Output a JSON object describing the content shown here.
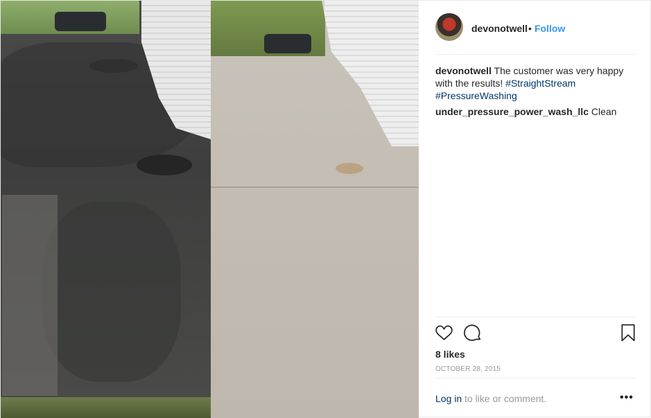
{
  "post": {
    "author": "devonotwell",
    "separator": "•",
    "follow_label": "Follow",
    "caption": {
      "user": "devonotwell",
      "text": "The customer was very happy with the results!",
      "hashtags": [
        "#StraightStream",
        "#PressureWashing"
      ]
    },
    "comments": [
      {
        "user": "under_pressure_power_wash_llc",
        "text": "Clean"
      }
    ],
    "likes": "8 likes",
    "date": "OCTOBER 28, 2015",
    "login_link": "Log in",
    "login_rest": " to like or comment.",
    "more_label": "•••"
  },
  "icons": {
    "like": "heart-icon",
    "comment": "comment-icon",
    "save": "bookmark-icon",
    "more": "more-options-icon"
  },
  "colors": {
    "link_blue": "#3897f0",
    "hashtag": "#003569",
    "muted": "#999999"
  }
}
